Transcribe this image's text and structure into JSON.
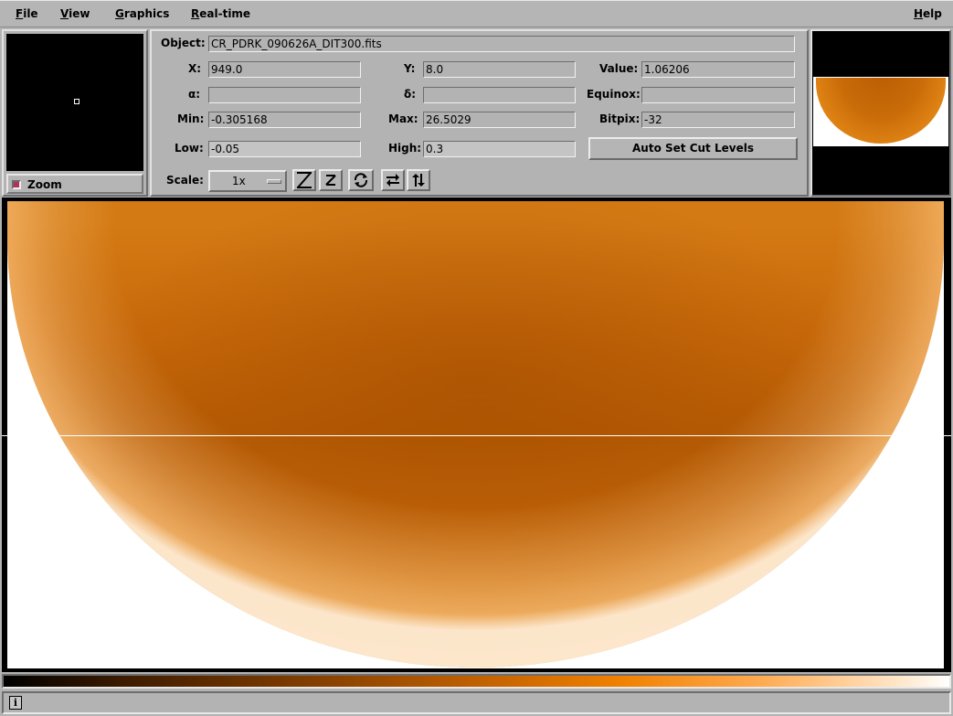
{
  "menu": {
    "file": "File",
    "view": "View",
    "graphics": "Graphics",
    "realtime": "Real-time",
    "help": "Help"
  },
  "zoom": {
    "label": "Zoom",
    "checked": true
  },
  "info": {
    "object_label": "Object:",
    "object_value": "CR_PDRK_090626A_DIT300.fits",
    "x_label": "X:",
    "x_value": "949.0",
    "y_label": "Y:",
    "y_value": "8.0",
    "value_label": "Value:",
    "value_value": "1.06206",
    "alpha_label": "α:",
    "alpha_value": "",
    "delta_label": "δ:",
    "delta_value": "",
    "equinox_label": "Equinox:",
    "equinox_value": "",
    "min_label": "Min:",
    "min_value": "-0.305168",
    "max_label": "Max:",
    "max_value": "26.5029",
    "bitpix_label": "Bitpix:",
    "bitpix_value": "-32",
    "low_label": "Low:",
    "low_value": "-0.05",
    "high_label": "High:",
    "high_value": "0.3",
    "autocut_label": "Auto Set Cut Levels",
    "scale_label": "Scale:",
    "scale_value": "1x"
  },
  "toolbar_icons": [
    "zoom-in-icon",
    "zoom-out-icon",
    "rotate-icon",
    "flip-x-icon",
    "flip-y-icon"
  ],
  "colors": {
    "background": "#b3b3b3",
    "image_orange": "#c86b08",
    "zoom_check": "#b03060"
  },
  "status": {
    "icon": "i"
  }
}
